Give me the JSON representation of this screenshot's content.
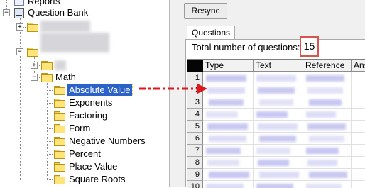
{
  "tree": {
    "reports_label": "Reports",
    "bank_label": "Question Bank",
    "math_label": "Math",
    "items": [
      {
        "label": "Absolute Value",
        "selected": true
      },
      {
        "label": "Exponents",
        "selected": false
      },
      {
        "label": "Factoring",
        "selected": false
      },
      {
        "label": "Form",
        "selected": false
      },
      {
        "label": "Negative Numbers",
        "selected": false
      },
      {
        "label": "Percent",
        "selected": false
      },
      {
        "label": "Place Value",
        "selected": false
      },
      {
        "label": "Square Roots",
        "selected": false
      }
    ],
    "expander_collapsed": "+",
    "expander_expanded": "−"
  },
  "toolbar": {
    "resync_label": "Resync"
  },
  "tabs": [
    {
      "label": "Questions",
      "active": true
    }
  ],
  "summary": {
    "total_label": "Total number of questions:",
    "total_count": "15"
  },
  "grid": {
    "columns": [
      "Type",
      "Text",
      "Reference",
      "Ans"
    ],
    "row_numbers": [
      "1",
      "2",
      "3",
      "4",
      "5",
      "6",
      "7",
      "8",
      "9",
      "10"
    ]
  },
  "colors": {
    "selection": "#2b62c8",
    "highlight_box": "#d9534f",
    "arrow": "#e0161e",
    "redacted": "#c8c8f4"
  }
}
